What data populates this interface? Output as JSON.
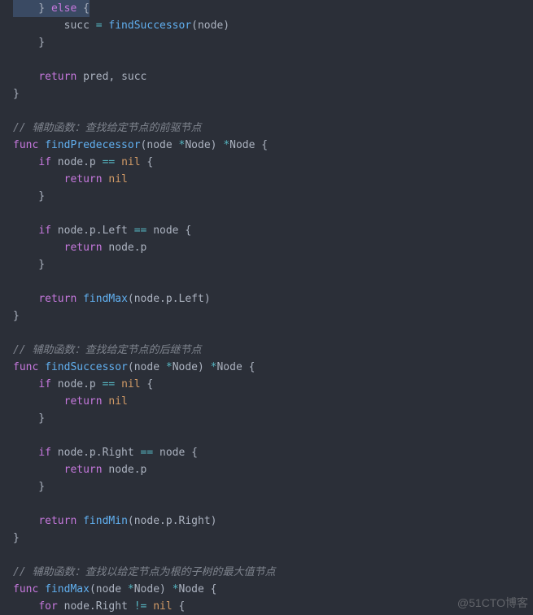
{
  "code": {
    "l01a": "    } ",
    "l01b": "else",
    "l01c": " {",
    "l02a": "        succ ",
    "l02b": "=",
    "l02c": " ",
    "l02d": "findSuccessor",
    "l02e": "(node)",
    "l03": "    }",
    "l04": "",
    "l05a": "    ",
    "l05b": "return",
    "l05c": " pred, succ",
    "l06": "}",
    "l07": "",
    "l08": "// 辅助函数：查找给定节点的前驱节点",
    "l09a": "func",
    "l09b": " ",
    "l09c": "findPredecessor",
    "l09d": "(node ",
    "l09e": "*",
    "l09f": "Node) ",
    "l09g": "*",
    "l09h": "Node {",
    "l10a": "    ",
    "l10b": "if",
    "l10c": " node.p ",
    "l10d": "==",
    "l10e": " ",
    "l10f": "nil",
    "l10g": " {",
    "l11a": "        ",
    "l11b": "return",
    "l11c": " ",
    "l11d": "nil",
    "l12": "    }",
    "l13": "",
    "l14a": "    ",
    "l14b": "if",
    "l14c": " node.p.Left ",
    "l14d": "==",
    "l14e": " node {",
    "l15a": "        ",
    "l15b": "return",
    "l15c": " node.p",
    "l16": "    }",
    "l17": "",
    "l18a": "    ",
    "l18b": "return",
    "l18c": " ",
    "l18d": "findMax",
    "l18e": "(node.p.Left)",
    "l19": "}",
    "l20": "",
    "l21": "// 辅助函数：查找给定节点的后继节点",
    "l22a": "func",
    "l22b": " ",
    "l22c": "findSuccessor",
    "l22d": "(node ",
    "l22e": "*",
    "l22f": "Node) ",
    "l22g": "*",
    "l22h": "Node {",
    "l23a": "    ",
    "l23b": "if",
    "l23c": " node.p ",
    "l23d": "==",
    "l23e": " ",
    "l23f": "nil",
    "l23g": " {",
    "l24a": "        ",
    "l24b": "return",
    "l24c": " ",
    "l24d": "nil",
    "l25": "    }",
    "l26": "",
    "l27a": "    ",
    "l27b": "if",
    "l27c": " node.p.Right ",
    "l27d": "==",
    "l27e": " node {",
    "l28a": "        ",
    "l28b": "return",
    "l28c": " node.p",
    "l29": "    }",
    "l30": "",
    "l31a": "    ",
    "l31b": "return",
    "l31c": " ",
    "l31d": "findMin",
    "l31e": "(node.p.Right)",
    "l32": "}",
    "l33": "",
    "l34": "// 辅助函数：查找以给定节点为根的子树的最大值节点",
    "l35a": "func",
    "l35b": " ",
    "l35c": "findMax",
    "l35d": "(node ",
    "l35e": "*",
    "l35f": "Node) ",
    "l35g": "*",
    "l35h": "Node {",
    "l36a": "    ",
    "l36b": "for",
    "l36c": " node.Right ",
    "l36d": "!=",
    "l36e": " ",
    "l36f": "nil",
    "l36g": " {"
  },
  "watermark": "@51CTO博客"
}
